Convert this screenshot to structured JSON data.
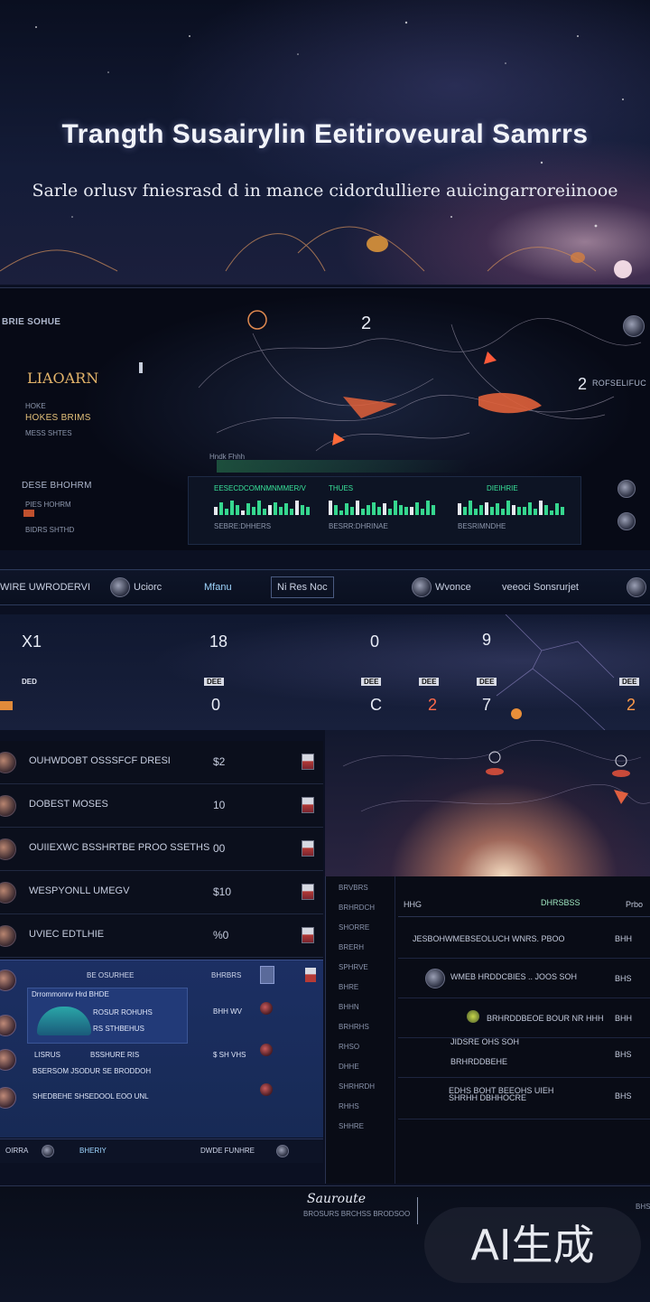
{
  "hero": {
    "title": "Trangth Susairylin Eeitiroveural Samrrs",
    "subtitle": "Sarle orlusv fniesrasd d in mance cidordulliere auicingarroreiinooe"
  },
  "map_panel": {
    "label_top_left": "BRIE SOHUE",
    "marker_number": "2",
    "right_marker_number": "2",
    "right_label": "ROFSELIFUC",
    "left_box_title": "LIAOARN",
    "left_box_line1": "HOKE",
    "left_box_line2": "HOKES BRIMS",
    "left_box_line3": "MESS SHTES",
    "small_caption": "Hndk Fhhh",
    "status_label": "DESE BHOHRM",
    "status_line1": "PIES HOHRM",
    "status_line2": "BIDRS SHTHD",
    "stats": [
      {
        "title": "EESECDCOMNMNMMER/V",
        "footer": "SEBRE:DHHERS"
      },
      {
        "title": "THUES",
        "footer": "BESRR:DHRINAE"
      },
      {
        "title": "DIEIHRIE",
        "footer": "BESRIMNDHE"
      }
    ]
  },
  "nav": {
    "items": [
      "WIRE UWRODERVI",
      "Uciorc",
      "Mfanu",
      "Ni Res Noc",
      "Wvonce",
      "veeoci Sonsrurjet"
    ]
  },
  "hud": {
    "numbers": [
      "X1",
      "18",
      "0",
      "9"
    ],
    "tags": [
      "DED",
      "DEE",
      "DEE",
      "DEE",
      "DEE",
      "DEE"
    ],
    "counters": [
      "0",
      "C",
      "2",
      "7",
      "2"
    ]
  },
  "list": {
    "rows": [
      {
        "label": "OUHWDOBT OSSSFCF DRESI",
        "value": "$2"
      },
      {
        "label": "DOBEST MOSES",
        "value": "10"
      },
      {
        "label": "OUIIEXWC BSSHRTBE PROO SSETHS",
        "value": "00"
      },
      {
        "label": "WESPYONLL UMEGV",
        "value": "$10"
      },
      {
        "label": "UVIEC EDTLHIE",
        "value": "%0"
      }
    ]
  },
  "selection": {
    "header_left": "BE OSURHEE",
    "header_right": "BHRBRS",
    "card_title": "Drrommonrw Hrd BHDE",
    "card_line1": "ROSUR ROHUHS",
    "card_line2": "RS STHBEHUS",
    "card_price": "BHH WV",
    "line_a_left": "LISRUS",
    "line_a_mid": "BSSHURE RIS",
    "line_a_price": "$ SH VHS",
    "line_b": "BSERSOM JSODUR SE BRODDOH",
    "line_c": "SHEDBEHE SHSEDOOL EOO UNL",
    "tab_left": "OIRRA",
    "tab_mid": "BHERIY",
    "tab_right": "DWDE FUNHRE"
  },
  "table": {
    "header_left": "HHG",
    "header_mid": "DHRSBSS",
    "header_right": "Prbo",
    "side_menu": [
      "BRVBRS",
      "BRHRDCH",
      "SHORRE",
      "BRERH",
      "SPHRVE",
      "BHRE",
      "BHHN",
      "BRHRHS",
      "RHSO",
      "DHHE",
      "SHRHRDH",
      "RHHS",
      "SHHRE"
    ],
    "rows": [
      {
        "text": "JESBOHWMEBSEOLUCH WNRS. PBOO",
        "price": "BHH"
      },
      {
        "text": "WMEB HRDDCBIES .. JOOS SOH",
        "price": "BHS"
      },
      {
        "text": "BRHRDDBEOE BOUR NR HHH",
        "price": "BHH"
      },
      {
        "text": "JIDSRE OHS SOH",
        "price": "BHS"
      },
      {
        "text": "BRHRDDBEHE",
        "price": ""
      },
      {
        "text": "EDHS BOHT BEEOHS UIEH",
        "price": "BHS"
      },
      {
        "text": "SHRHH DBHHOCRE",
        "price": ""
      }
    ]
  },
  "footer": {
    "logo_text": "Sauroute",
    "logo_sub": "BROSURS BRCHSS BRODSOO",
    "page_tag": "BHS",
    "watermark": "AI生成"
  }
}
